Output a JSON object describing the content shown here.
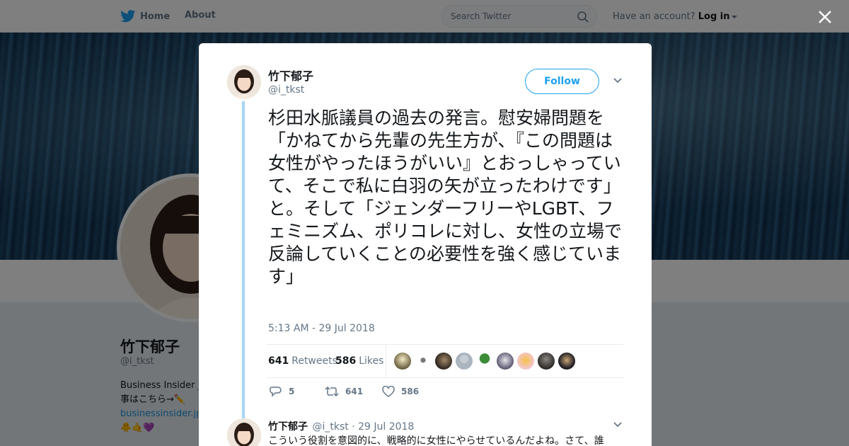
{
  "nav": {
    "home_label": "Home",
    "about_label": "About",
    "search_placeholder": "Search Twitter",
    "account_prompt": "Have an account?",
    "login_label": "Log in"
  },
  "profile": {
    "name": "竹下郁子",
    "handle": "@i_tkst",
    "bio_line1": "Business Insider J",
    "bio_line2": "事はこちら→✏️",
    "bio_link": "businessinsider.jp",
    "bio_emoji": "🐥🤙💜"
  },
  "tweet": {
    "author_name": "竹下郁子",
    "author_handle": "@i_tkst",
    "follow_label": "Follow",
    "text": "杉田水脈議員の過去の発言。慰安婦問題を「かねてから先輩の先生方が、『この問題は女性がやったほうがいい』とおっしゃっていて、そこで私に白羽の矢が立ったわけです」と。そして「ジェンダーフリーやLGBT、フェミニズム、ポリコレに対し、女性の立場で反論していくことの必要性を強く感じています」",
    "timestamp": "5:13 AM - 29 Jul 2018",
    "retweet_count": "641",
    "retweet_label": "Retweets",
    "like_count": "586",
    "like_label": "Likes",
    "reply_action_count": "5",
    "retweet_action_count": "641",
    "like_action_count": "586"
  },
  "reply": {
    "author_name": "竹下郁子",
    "author_handle": "@i_tkst",
    "date": "· 29 Jul 2018",
    "text": "こういう役割を意図的に、戦略的に女性にやらせているんだよね。さて、誰"
  },
  "colors": {
    "accent": "#1da1f2",
    "thread_line": "#a6d4f2",
    "muted": "#657786"
  }
}
